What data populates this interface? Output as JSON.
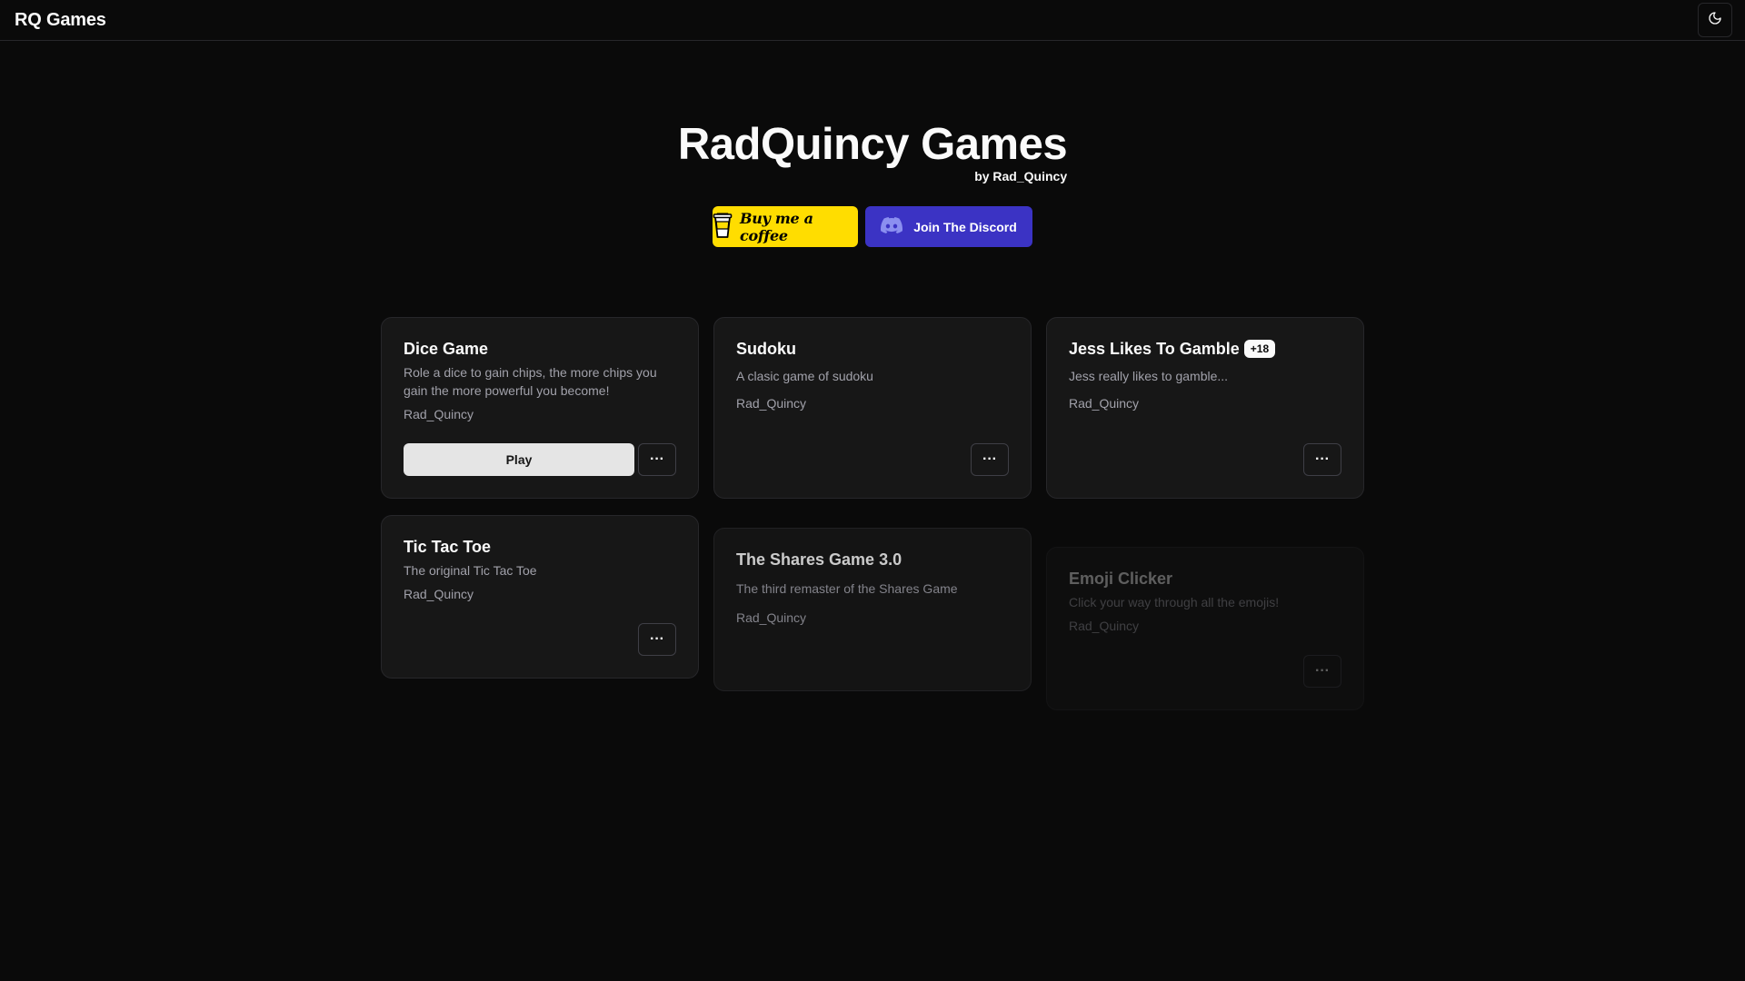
{
  "navbar": {
    "brand": "RQ Games",
    "theme_toggle_icon": "moon-icon"
  },
  "hero": {
    "title": "RadQuincy Games",
    "subtitle": "by Rad_Quincy"
  },
  "cta": {
    "coffee_label": "Buy me a coffee",
    "coffee_color": "#ffdd00",
    "discord_label": "Join The Discord",
    "discord_color": "#3b33c4"
  },
  "games": [
    {
      "title": "Dice Game",
      "description": "Role a dice to gain chips, the more chips you gain the more powerful you become!",
      "author": "Rad_Quincy",
      "play_label": "Play",
      "more_label": "···"
    },
    {
      "title": "Sudoku",
      "description": "A clasic game of sudoku",
      "author": "Rad_Quincy",
      "more_label": "···"
    },
    {
      "title": "Jess Likes To Gamble",
      "badge": "+18",
      "description": "Jess really likes to gamble...",
      "author": "Rad_Quincy",
      "more_label": "···"
    },
    {
      "title": "Tic Tac Toe",
      "description": "The original Tic Tac Toe",
      "author": "Rad_Quincy",
      "more_label": "···"
    },
    {
      "title": "The Shares Game 3.0",
      "description": "The third remaster of the Shares Game",
      "author": "Rad_Quincy"
    },
    {
      "title": "Emoji Clicker",
      "description": "Click your way through all the emojis!",
      "author": "Rad_Quincy",
      "more_label": "···"
    }
  ]
}
